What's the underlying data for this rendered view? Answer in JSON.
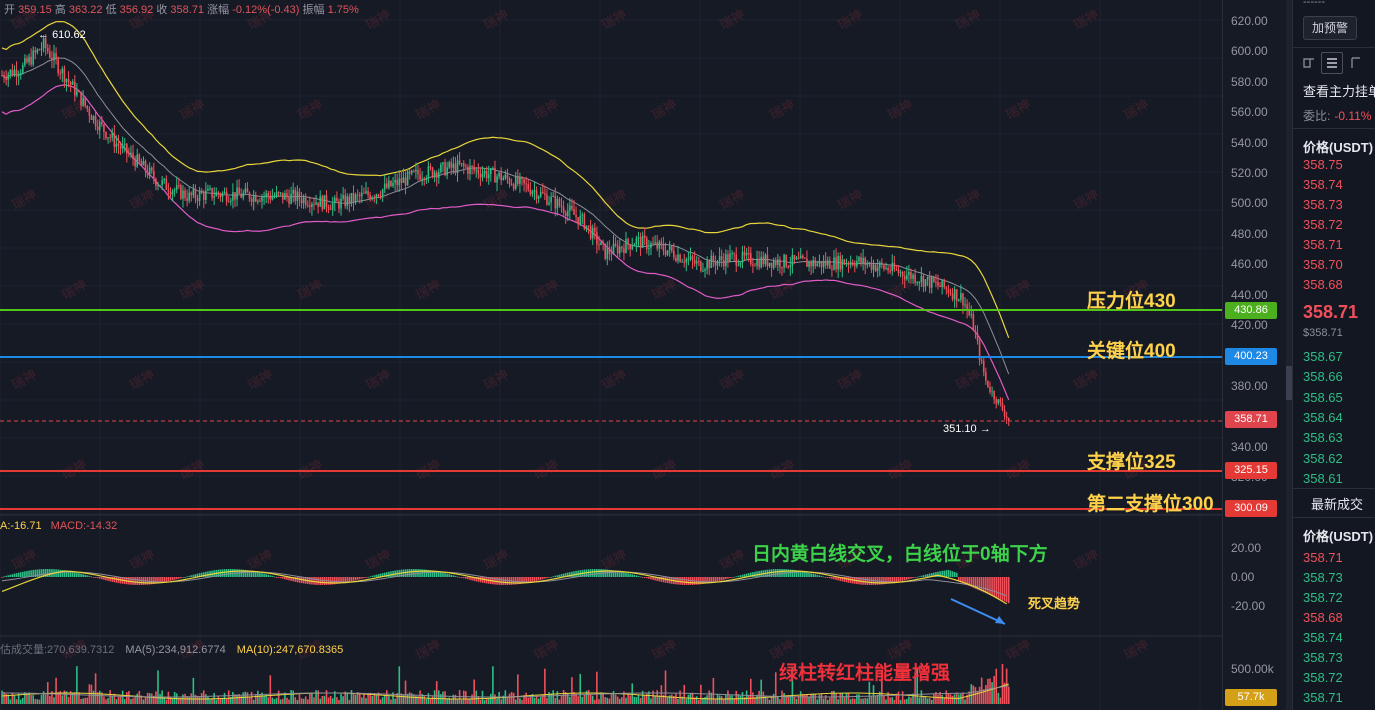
{
  "ohlc": {
    "open_label": "开",
    "open": "359.15",
    "high_label": "高",
    "high": "363.22",
    "low_label": "低",
    "low": "356.92",
    "close_label": "收",
    "close": "358.71",
    "change_label": "涨幅",
    "change": "-0.12%(-0.43)",
    "amplitude_label": "振幅",
    "amplitude": "1.75%"
  },
  "price_axis": [
    "620.00",
    "600.00",
    "580.00",
    "560.00",
    "540.00",
    "520.00",
    "500.00",
    "480.00",
    "460.00",
    "440.00",
    "420.00",
    "380.00",
    "340.00",
    "320.00"
  ],
  "price_tags": {
    "resistance": "430.86",
    "key": "400.23",
    "last": "358.71",
    "support": "325.15",
    "support2": "300.09"
  },
  "annotations": {
    "resistance": "压力位430",
    "key": "关键位400",
    "support": "支撑位325",
    "support2": "第二支撑位300",
    "high_marker": "610.62",
    "low_marker": "351.10",
    "macd_note": "日内黄白线交叉，白线位于0轴下方",
    "death_cross": "死叉趋势",
    "volume_note": "绿柱转红柱能量增强"
  },
  "macd": {
    "dea": "A:-16.71",
    "macd": "MACD:-14.32",
    "axis": [
      "20.00",
      "0.00",
      "-20.00"
    ]
  },
  "volume": {
    "total": "估成交量:270,639.7312",
    "ma5": "MA(5):234,912.6774",
    "ma10": "MA(10):247,670.8365",
    "axis": "500.00k",
    "last": "57.7k"
  },
  "watermark": "瑞神",
  "colors": {
    "up": "#2ebd85",
    "down": "#f0505a",
    "resistance": "#52c41a",
    "key": "#1e88e5",
    "support": "#e53935",
    "ann": "#ffd24a"
  },
  "sidebar": {
    "dashes": "------",
    "add_alert": "加预警",
    "view_orders": "查看主力挂单",
    "ratio_label": "委比:",
    "ratio_value": "-0.11%",
    "price_header": "价格(USDT)",
    "asks": [
      "358.75",
      "358.74",
      "358.73",
      "358.72",
      "358.71",
      "358.70",
      "358.68"
    ],
    "last_price": "358.71",
    "last_price_usd": "$358.71",
    "bids": [
      "358.67",
      "358.66",
      "358.65",
      "358.64",
      "358.63",
      "358.62",
      "358.61"
    ],
    "trades_title": "最新成交",
    "trades_header": "价格(USDT)",
    "trades": [
      {
        "p": "358.71",
        "c": "red"
      },
      {
        "p": "358.73",
        "c": "green"
      },
      {
        "p": "358.72",
        "c": "green"
      },
      {
        "p": "358.68",
        "c": "red"
      },
      {
        "p": "358.74",
        "c": "green"
      },
      {
        "p": "358.73",
        "c": "green"
      },
      {
        "p": "358.72",
        "c": "green"
      },
      {
        "p": "358.71",
        "c": "green"
      }
    ]
  }
}
